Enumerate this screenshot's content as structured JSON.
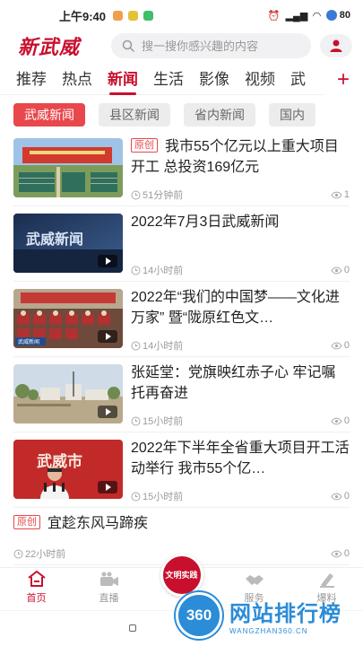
{
  "status": {
    "time": "上午9:40",
    "battery": "80",
    "app_icon_colors": [
      "#f0a04b",
      "#e3c23a",
      "#3fbf6a"
    ]
  },
  "header": {
    "logo": "新武威",
    "search_placeholder": "搜一搜你感兴趣的内容"
  },
  "channels": {
    "items": [
      "推荐",
      "热点",
      "新闻",
      "生活",
      "影像",
      "视频",
      "武"
    ],
    "active_index": 2,
    "add_label": "+"
  },
  "subtabs": {
    "items": [
      "武威新闻",
      "县区新闻",
      "省内新闻",
      "国内"
    ],
    "active_index": 0
  },
  "news": [
    {
      "tag": "原创",
      "title": "我市55个亿元以上重大项目开工 总投资169亿元",
      "time": "51分钟前",
      "views": "1",
      "thumb": "construction",
      "video": false
    },
    {
      "tag": "",
      "title": "2022年7月3日武威新闻",
      "time": "14小时前",
      "views": "0",
      "thumb": "broadcast",
      "video": true
    },
    {
      "tag": "",
      "title": "2022年“我们的中国梦——文化进万家” 暨“陇原红色文…",
      "time": "14小时前",
      "views": "0",
      "thumb": "stage",
      "video": true
    },
    {
      "tag": "",
      "title": "张延堂：党旗映红赤子心 牢记嘱托再奋进",
      "time": "15小时前",
      "views": "0",
      "thumb": "village",
      "video": true
    },
    {
      "tag": "",
      "title": "2022年下半年全省重大项目开工活动举行 我市55个亿…",
      "time": "15小时前",
      "views": "0",
      "thumb": "speech",
      "video": true
    },
    {
      "tag": "原创",
      "title": "宜趁东风马蹄疾",
      "time": "22小时前",
      "views": "0",
      "thumb": "",
      "video": false
    }
  ],
  "thumb_text": {
    "broadcast": "武威新闻",
    "speech": "武威市",
    "stage_caption": "武威新闻"
  },
  "bottom_nav": {
    "home": "首页",
    "live": "直播",
    "center": "文明实践",
    "service": "服务",
    "report": "爆料"
  },
  "watermark": {
    "logo": "360",
    "title": "网站排行榜",
    "url": "WANGZHAN360.CN"
  },
  "colors": {
    "brand_red": "#c8102e",
    "tab_active": "#e8474b",
    "watermark_blue": "#2b8cd8"
  }
}
